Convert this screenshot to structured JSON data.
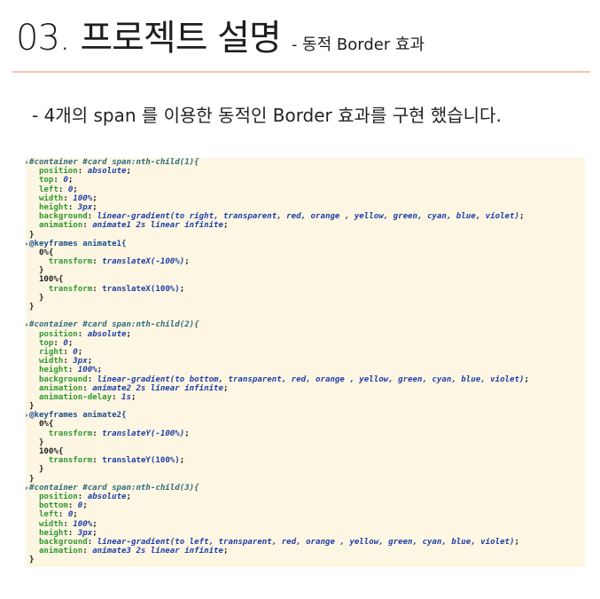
{
  "header": {
    "title": "03. 프로젝트 설명",
    "subtitle": "- 동적 Border 효과"
  },
  "description": "- 4개의 span 를 이용한 동적인 Border 효과를 구현 했습니다.",
  "colors": {
    "divider": "#f2c4b8",
    "code_background": "#fdf6e3",
    "selector": "#2e6a78",
    "property": "#2d9a2d",
    "value": "#1f3ea8"
  },
  "code_lines": [
    {
      "type": "selector",
      "indent": 0,
      "marker": true,
      "text": "#container #card span:nth-child(1){"
    },
    {
      "type": "decl",
      "indent": 1,
      "prop": "position",
      "val": "absolute",
      "vstyle": "i"
    },
    {
      "type": "decl",
      "indent": 1,
      "prop": "top",
      "val": "0",
      "vstyle": "i"
    },
    {
      "type": "decl",
      "indent": 1,
      "prop": "left",
      "val": "0",
      "vstyle": "i"
    },
    {
      "type": "decl",
      "indent": 1,
      "prop": "width",
      "val": "100%",
      "vstyle": "i"
    },
    {
      "type": "decl",
      "indent": 1,
      "prop": "height",
      "val": "3px",
      "vstyle": "i"
    },
    {
      "type": "decl",
      "indent": 1,
      "prop": "background",
      "val": "linear-gradient(to right, transparent, red, orange , yellow, green, cyan, blue, violet)",
      "vstyle": "i"
    },
    {
      "type": "decl",
      "indent": 1,
      "prop": "animation",
      "val": "animate1 2s linear infinite",
      "vstyle": "i"
    },
    {
      "type": "plain",
      "indent": 0,
      "text": "}"
    },
    {
      "type": "at",
      "indent": 0,
      "marker": true,
      "text": "@keyframes animate1{"
    },
    {
      "type": "plain",
      "indent": 1,
      "text": "0%{"
    },
    {
      "type": "decl",
      "indent": 2,
      "prop": "transform",
      "val": "translateX(-100%)",
      "vstyle": "i"
    },
    {
      "type": "plain",
      "indent": 1,
      "text": "}"
    },
    {
      "type": "plain",
      "indent": 1,
      "text": "100%{"
    },
    {
      "type": "decl",
      "indent": 2,
      "prop": "transform",
      "val": "translateX(100%)",
      "vstyle": "n"
    },
    {
      "type": "plain",
      "indent": 1,
      "text": "}"
    },
    {
      "type": "plain",
      "indent": 0,
      "text": "}"
    },
    {
      "type": "blank",
      "indent": 0,
      "text": ""
    },
    {
      "type": "selector",
      "indent": 0,
      "marker": true,
      "text": "#container #card span:nth-child(2){"
    },
    {
      "type": "decl",
      "indent": 1,
      "prop": "position",
      "val": "absolute",
      "vstyle": "i"
    },
    {
      "type": "decl",
      "indent": 1,
      "prop": "top",
      "val": "0",
      "vstyle": "i"
    },
    {
      "type": "decl",
      "indent": 1,
      "prop": "right",
      "val": "0",
      "vstyle": "i"
    },
    {
      "type": "decl",
      "indent": 1,
      "prop": "width",
      "val": "3px",
      "vstyle": "i"
    },
    {
      "type": "decl",
      "indent": 1,
      "prop": "height",
      "val": "100%",
      "vstyle": "i"
    },
    {
      "type": "decl",
      "indent": 1,
      "prop": "background",
      "val": "linear-gradient(to bottom, transparent, red, orange , yellow, green, cyan, blue, violet)",
      "vstyle": "i"
    },
    {
      "type": "decl",
      "indent": 1,
      "prop": "animation",
      "val": "animate2 2s linear infinite",
      "vstyle": "i"
    },
    {
      "type": "decl",
      "indent": 1,
      "prop": "animation-delay",
      "val": "1s",
      "vstyle": "i"
    },
    {
      "type": "plain",
      "indent": 0,
      "text": "}"
    },
    {
      "type": "at",
      "indent": 0,
      "marker": true,
      "text": "@keyframes animate2{"
    },
    {
      "type": "plain",
      "indent": 1,
      "text": "0%{"
    },
    {
      "type": "decl",
      "indent": 2,
      "prop": "transform",
      "val": "translateY(-100%)",
      "vstyle": "i"
    },
    {
      "type": "plain",
      "indent": 1,
      "text": "}"
    },
    {
      "type": "plain",
      "indent": 1,
      "text": "100%{"
    },
    {
      "type": "decl",
      "indent": 2,
      "prop": "transform",
      "val": "translateY(100%)",
      "vstyle": "n"
    },
    {
      "type": "plain",
      "indent": 1,
      "text": "}"
    },
    {
      "type": "plain",
      "indent": 0,
      "text": "}"
    },
    {
      "type": "selector",
      "indent": 0,
      "marker": true,
      "text": "#container #card span:nth-child(3){"
    },
    {
      "type": "decl",
      "indent": 1,
      "prop": "position",
      "val": "absolute",
      "vstyle": "i"
    },
    {
      "type": "decl",
      "indent": 1,
      "prop": "bottom",
      "val": "0",
      "vstyle": "i"
    },
    {
      "type": "decl",
      "indent": 1,
      "prop": "left",
      "val": "0",
      "vstyle": "i"
    },
    {
      "type": "decl",
      "indent": 1,
      "prop": "width",
      "val": "100%",
      "vstyle": "i"
    },
    {
      "type": "decl",
      "indent": 1,
      "prop": "height",
      "val": "3px",
      "vstyle": "i"
    },
    {
      "type": "decl",
      "indent": 1,
      "prop": "background",
      "val": "linear-gradient(to left, transparent, red, orange , yellow, green, cyan, blue, violet)",
      "vstyle": "i"
    },
    {
      "type": "decl",
      "indent": 1,
      "prop": "animation",
      "val": "animate3 2s linear infinite",
      "vstyle": "i"
    },
    {
      "type": "plain",
      "indent": 0,
      "text": "}"
    }
  ]
}
